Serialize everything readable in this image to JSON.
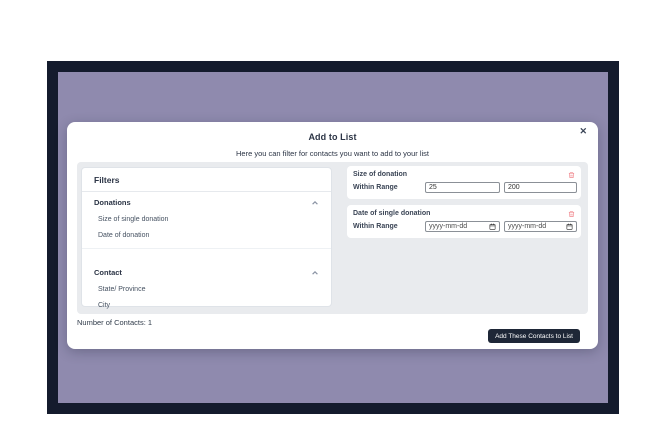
{
  "window": {
    "frame_color": "#141b2d",
    "backdrop_color": "#8f8aae"
  },
  "modal": {
    "title": "Add to List",
    "subtitle": "Here you can filter for contacts you want to add to your list",
    "close_icon": "✕",
    "filters_panel": {
      "heading": "Filters",
      "sections": [
        {
          "label": "Donations",
          "items": [
            "Size of single donation",
            "Date of donation"
          ]
        },
        {
          "label": "Contact",
          "items": [
            "State/ Province",
            "City"
          ]
        }
      ]
    },
    "active_filters": [
      {
        "title": "Size of donation",
        "row_label": "Within Range",
        "min_value": "25",
        "max_value": "200"
      },
      {
        "title": "Date of single donation",
        "row_label": "Within Range",
        "min_placeholder": "yyyy-mm-dd",
        "max_placeholder": "yyyy-mm-dd"
      }
    ],
    "footer": {
      "count_text": "Number of Contacts: 1",
      "submit_label": "Add These Contacts to List"
    }
  },
  "colors": {
    "danger_icon": "#f0868c",
    "button_bg": "#1e2737",
    "band_bg": "#e9ebee"
  }
}
